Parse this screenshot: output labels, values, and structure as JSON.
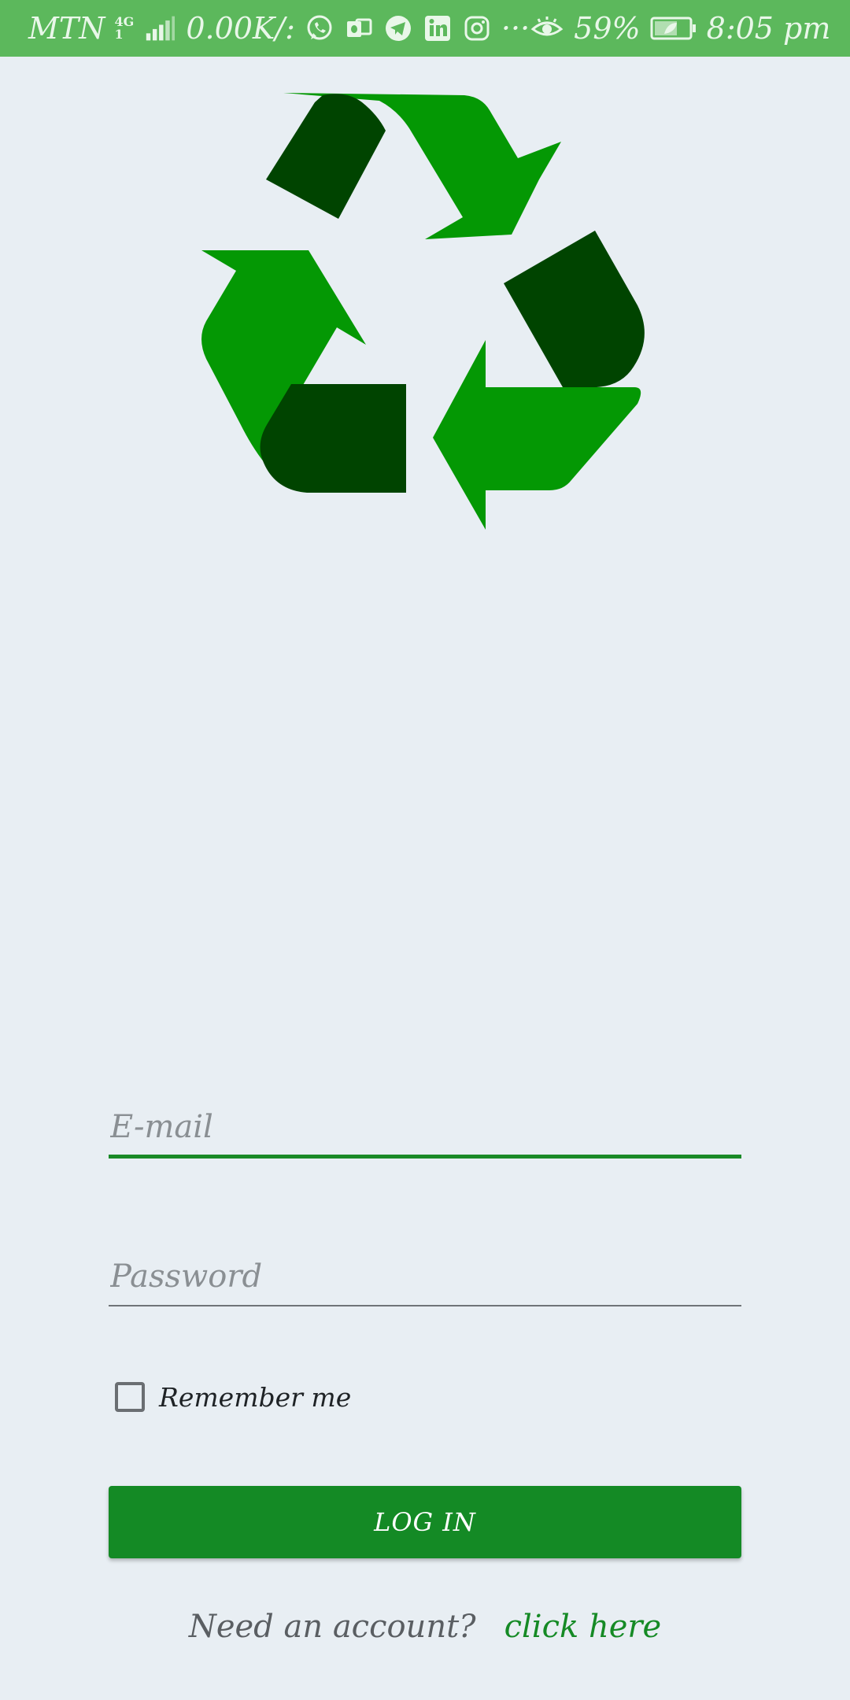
{
  "status_bar": {
    "carrier": "MTN",
    "network_type_top": "4G",
    "network_type_bottom": "1",
    "data_speed": "0.00K/:",
    "notification_icons": [
      "whatsapp-icon",
      "outlook-icon",
      "telegram-icon",
      "linkedin-icon",
      "instagram-icon"
    ],
    "more_indicator": "···",
    "battery_percent": "59%",
    "time": "8:05 pm",
    "background_color": "#5cb85c"
  },
  "logo": {
    "icon": "recycle-icon",
    "colors": {
      "light": "#049804",
      "dark": "#004400"
    }
  },
  "form": {
    "email": {
      "placeholder": "E-mail",
      "value": "",
      "focused": true
    },
    "password": {
      "placeholder": "Password",
      "value": ""
    },
    "remember_me": {
      "label": "Remember me",
      "checked": false
    },
    "login_button": {
      "label": "LOG IN",
      "color": "#148a25"
    }
  },
  "signup": {
    "prompt": "Need an account?",
    "link_label": "click here",
    "link_color": "#158a25"
  },
  "colors": {
    "background": "#e8eef3",
    "accent": "#148a25"
  }
}
